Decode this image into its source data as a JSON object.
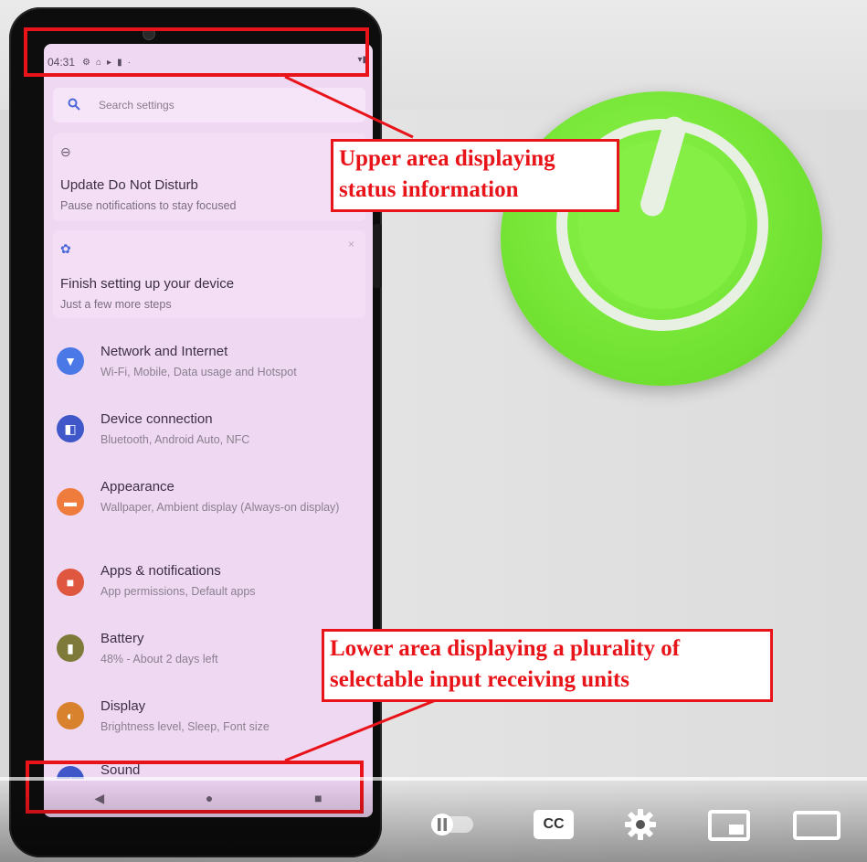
{
  "status_bar": {
    "time": "04:31",
    "icons": [
      "⚙",
      "⌂",
      "▸",
      "▮",
      "·"
    ],
    "right_icons": "▾▮"
  },
  "search": {
    "placeholder": "Search settings"
  },
  "cards": [
    {
      "icon": "⊖",
      "title": "Update Do Not Disturb",
      "subtitle": "Pause notifications to stay focused"
    },
    {
      "icon": "✿",
      "title": "Finish setting up your device",
      "subtitle": "Just a few more steps",
      "close": "×"
    }
  ],
  "items": [
    {
      "title": "Network and Internet",
      "subtitle": "Wi-Fi, Mobile, Data usage and Hotspot",
      "color": "#4a78e6",
      "icon": "▼"
    },
    {
      "title": "Device connection",
      "subtitle": "Bluetooth, Android Auto, NFC",
      "color": "#3f57c8",
      "icon": "◧"
    },
    {
      "title": "Appearance",
      "subtitle": "Wallpaper, Ambient display (Always-on display)",
      "color": "#ef7b3c",
      "icon": "▬"
    },
    {
      "title": "Apps & notifications",
      "subtitle": "App permissions, Default apps",
      "color": "#e0573f",
      "icon": "■"
    },
    {
      "title": "Battery",
      "subtitle": "48% - About 2 days left",
      "color": "#7d7a3a",
      "icon": "▮"
    },
    {
      "title": "Display",
      "subtitle": "Brightness level, Sleep, Font size",
      "color": "#d9822e",
      "icon": "◐"
    },
    {
      "title": "Sound",
      "subtitle": "",
      "color": "#3f57c8",
      "icon": "♪"
    }
  ],
  "navbar": {
    "back": "◀",
    "home": "●",
    "recents": "■"
  },
  "annotations": {
    "upper": "Upper area displaying status information",
    "upper_line1": "Upper area displaying",
    "upper_line2": "status information",
    "lower_line1": "Lower area displaying a plurality of",
    "lower_line2": "selectable input receiving units"
  },
  "player": {
    "cc": "CC"
  }
}
